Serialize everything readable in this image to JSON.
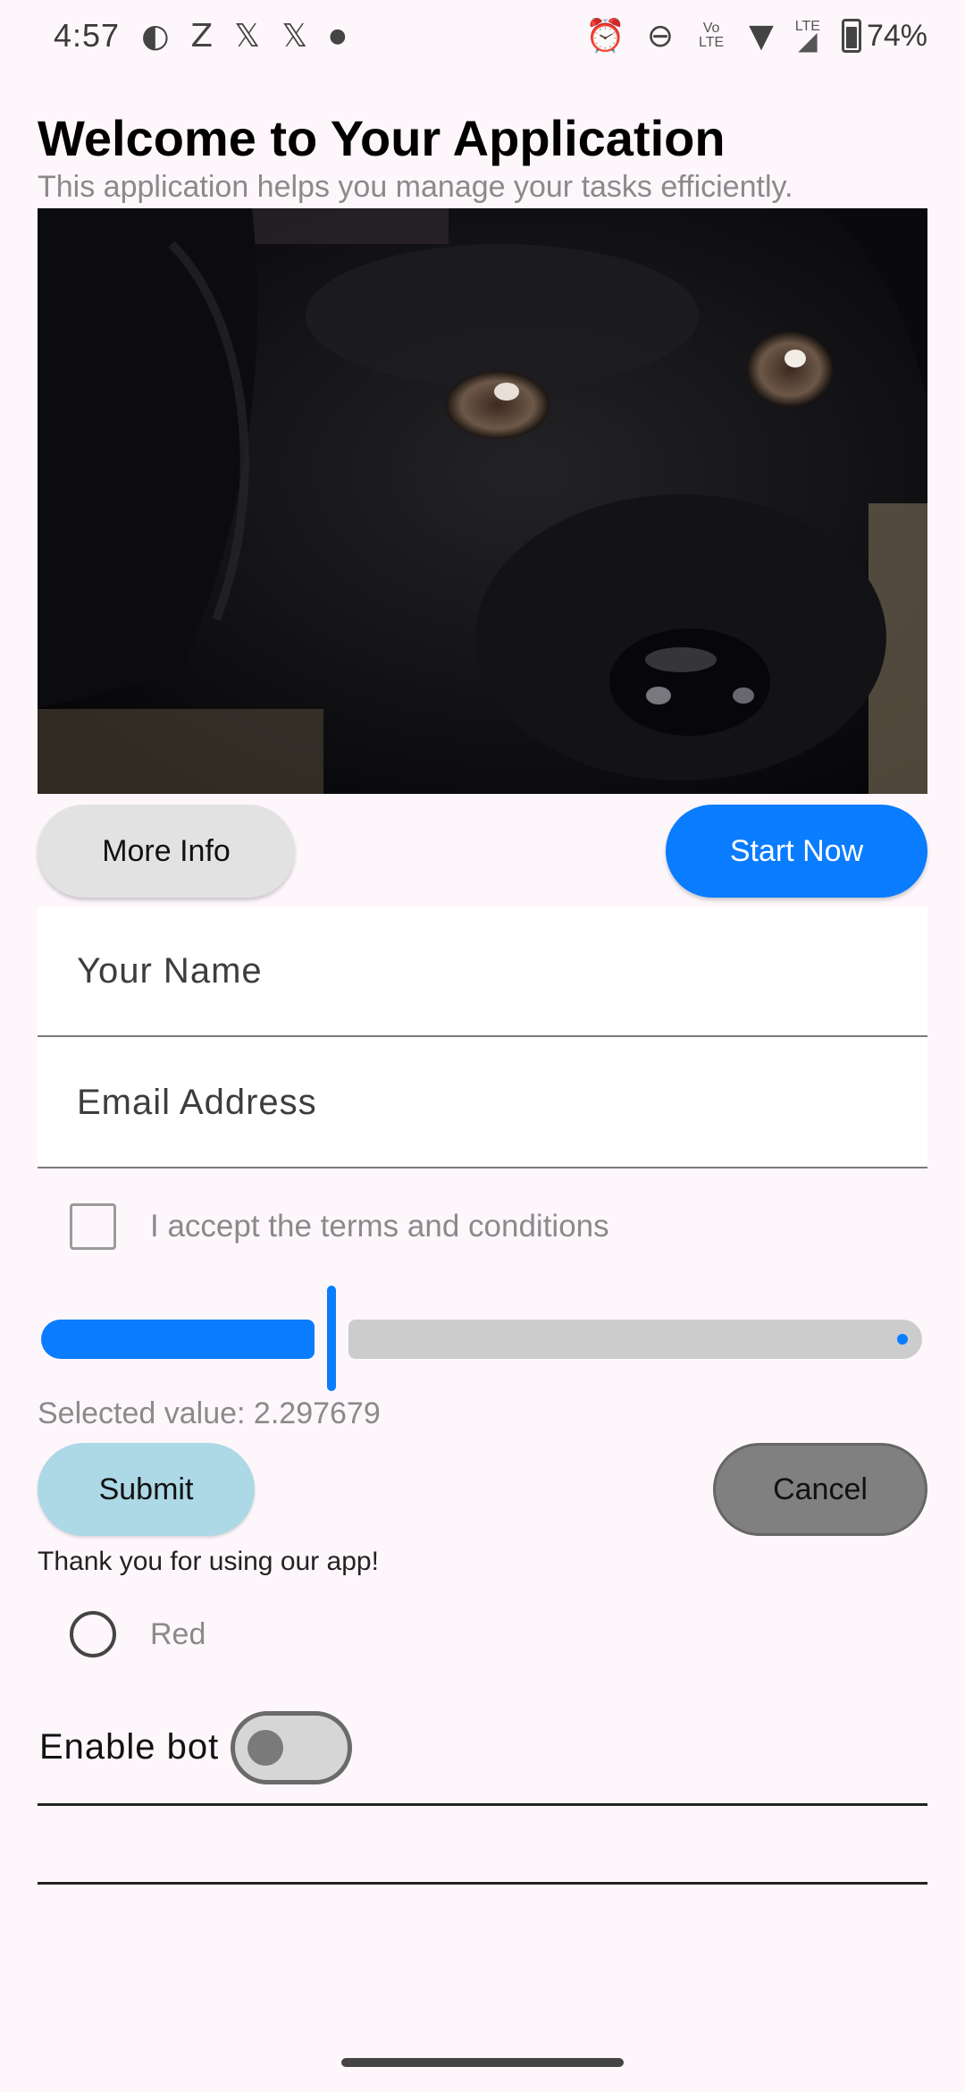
{
  "status_bar": {
    "time": "4:57",
    "left_icons": [
      "p-circle-icon",
      "z-icon",
      "x-icon",
      "x-icon",
      "dot-icon"
    ],
    "volte_text": "Vo LTE",
    "lte_text": "LTE",
    "battery_percent": "74%"
  },
  "header": {
    "title": "Welcome to Your Application",
    "subtitle": "This application helps you manage your tasks efficiently."
  },
  "actions": {
    "more_info": "More Info",
    "start_now": "Start Now"
  },
  "form": {
    "name_placeholder": "Your Name",
    "email_placeholder": "Email Address",
    "terms_label": "I accept the terms and conditions",
    "terms_checked": false
  },
  "slider": {
    "value": 2.297679,
    "fraction": 0.33,
    "value_text": "Selected value: 2.297679"
  },
  "buttons": {
    "submit": "Submit",
    "cancel": "Cancel"
  },
  "thanks_text": "Thank you for using our app!",
  "radio": {
    "label": "Red",
    "selected": false
  },
  "toggle": {
    "label": "Enable bot",
    "on": false
  },
  "colors": {
    "primary": "#0a7cff",
    "background": "#fdf7fc",
    "submit_bg": "#add8e6",
    "cancel_bg": "#808080"
  }
}
